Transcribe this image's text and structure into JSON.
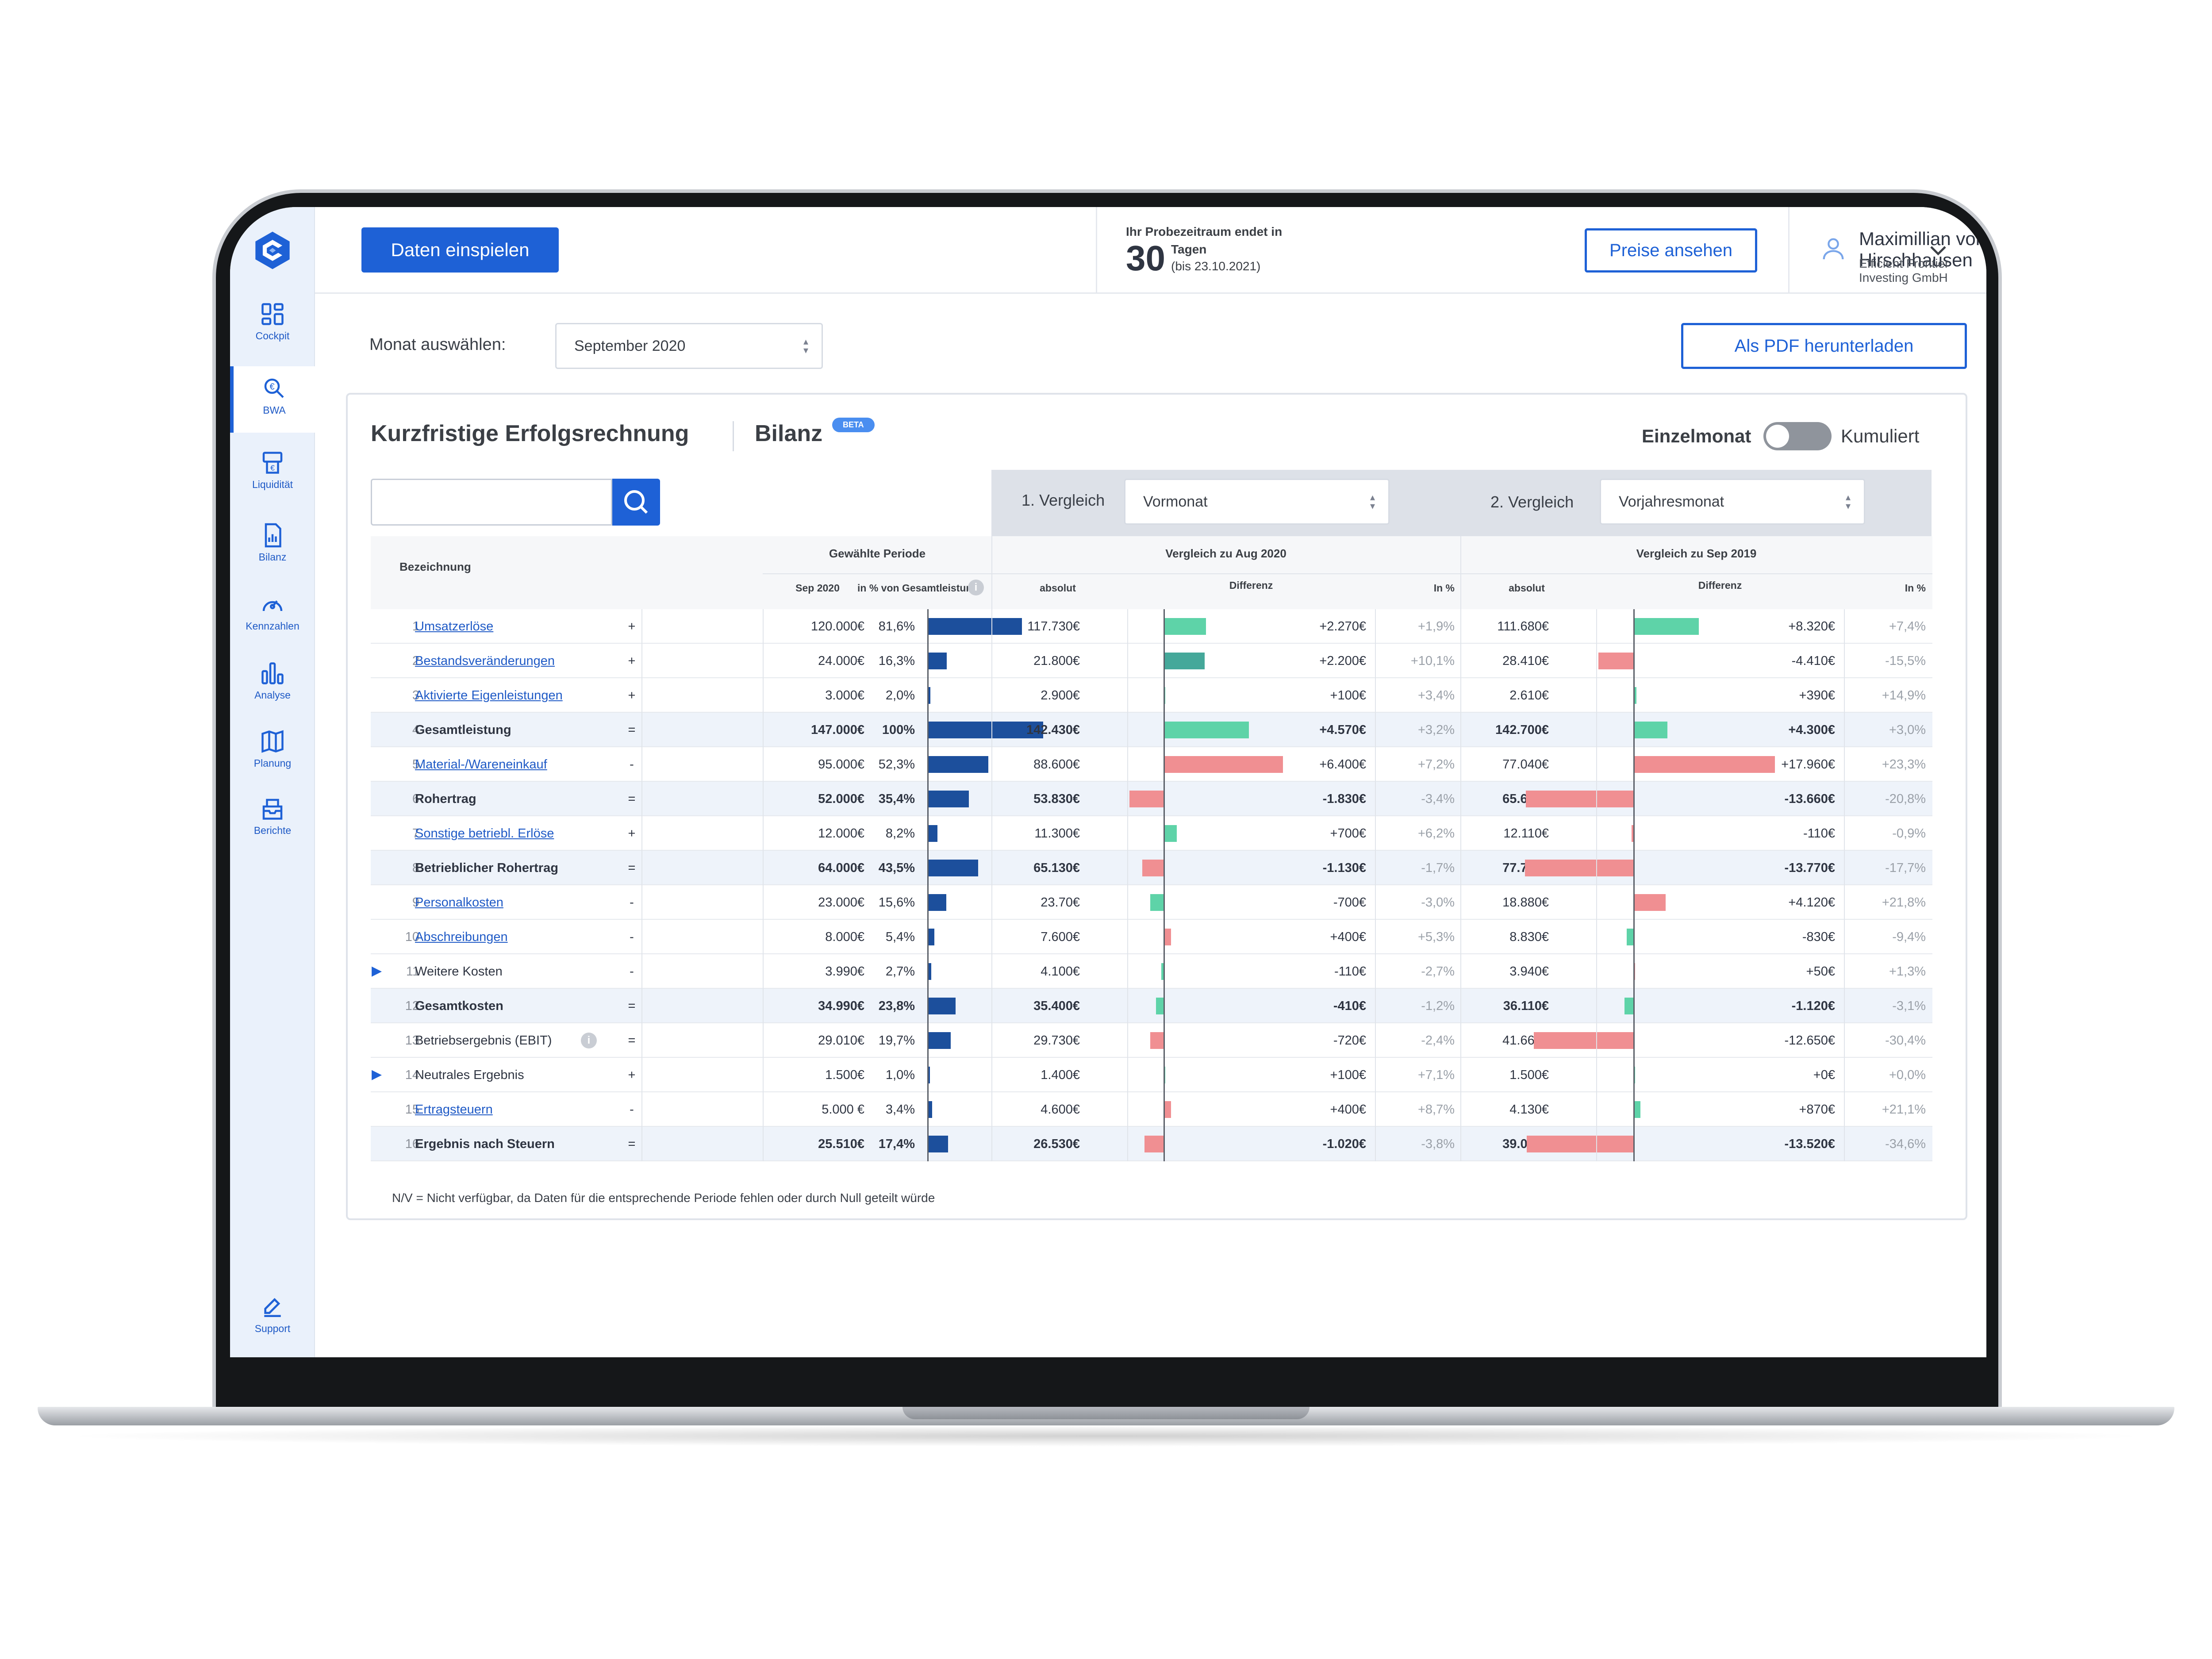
{
  "nav": [
    {
      "label": "Cockpit",
      "icon": "cockpit-icon"
    },
    {
      "label": "BWA",
      "icon": "bwa-icon"
    },
    {
      "label": "Liquidität",
      "icon": "liquidity-icon"
    },
    {
      "label": "Bilanz",
      "icon": "balance-icon"
    },
    {
      "label": "Kennzahlen",
      "icon": "gauge-icon"
    },
    {
      "label": "Analyse",
      "icon": "analysis-icon"
    },
    {
      "label": "Planung",
      "icon": "planning-icon"
    },
    {
      "label": "Berichte",
      "icon": "reports-icon"
    }
  ],
  "support_label": "Support",
  "header": {
    "import_button": "Daten einspielen",
    "trial_title": "Ihr Probezeitraum endet in",
    "trial_days": "30",
    "trial_unit": "Tagen",
    "trial_date": "(bis 23.10.2021)",
    "prices_button": "Preise ansehen",
    "user_name": "Maximillian von Hirschhausen",
    "company": "Efficient Frontier Investing GmbH"
  },
  "toolbar": {
    "month_label": "Monat auswählen:",
    "month_value": "September 2020",
    "pdf_button": "Als PDF herunterladen"
  },
  "report": {
    "title": "Kurzfristige Erfolgsrechnung",
    "tab2": "Bilanz",
    "beta": "BETA",
    "toggle_left": "Einzelmonat",
    "toggle_right": "Kumuliert",
    "cmp1_label": "1. Vergleich",
    "cmp1_value": "Vormonat",
    "cmp2_label": "2. Vergleich",
    "cmp2_value": "Vorjahresmonat"
  },
  "table": {
    "col_name": "Bezeichnung",
    "grp_selected": "Gewählte Periode",
    "grp_cmp1": "Vergleich zu Aug 2020",
    "grp_cmp2": "Vergleich zu Sep 2019",
    "sub_period": "Sep 2020",
    "sub_share": "in % von Gesamtleistung",
    "sub_abs1": "absolut",
    "sub_diff1": "Differenz",
    "sub_pct1": "In %",
    "sub_abs2": "absolut",
    "sub_diff2": "Differenz",
    "sub_pct2": "In %",
    "rows": [
      {
        "n": "1",
        "name": "Umsatzerlöse",
        "link": true,
        "bold": false,
        "op": "+",
        "val": "120.000€",
        "share": "81,6%",
        "shareV": 81.6,
        "a1": "117.730€",
        "d1": "+2.270€",
        "d1v": 2270,
        "p1": "+1,9%",
        "a2": "111.680€",
        "d2": "+8.320€",
        "d2v": 8320,
        "p2": "+7,4%"
      },
      {
        "n": "2",
        "name": "Bestandsveränderungen",
        "link": true,
        "bold": false,
        "op": "+",
        "val": "24.000€",
        "share": "16,3%",
        "shareV": 16.3,
        "a1": "21.800€",
        "d1": "+2.200€",
        "d1v": 2200,
        "p1": "+10,1%",
        "a2": "28.410€",
        "d2": "-4.410€",
        "d2v": -4410,
        "p2": "-15,5%"
      },
      {
        "n": "3",
        "name": "Aktivierte Eigenleistungen",
        "link": true,
        "bold": false,
        "op": "+",
        "val": "3.000€",
        "share": "2,0%",
        "shareV": 2.0,
        "a1": "2.900€",
        "d1": "+100€",
        "d1v": 100,
        "p1": "+3,4%",
        "a2": "2.610€",
        "d2": "+390€",
        "d2v": 390,
        "p2": "+14,9%"
      },
      {
        "n": "4",
        "name": "Gesamtleistung",
        "link": false,
        "bold": true,
        "op": "=",
        "val": "147.000€",
        "share": "100%",
        "shareV": 100,
        "a1": "142.430€",
        "d1": "+4.570€",
        "d1v": 4570,
        "p1": "+3,2%",
        "a2": "142.700€",
        "d2": "+4.300€",
        "d2v": 4300,
        "p2": "+3,0%"
      },
      {
        "n": "5",
        "name": "Material-/Wareneinkauf",
        "link": true,
        "bold": false,
        "op": "-",
        "val": "95.000€",
        "share": "52,3%",
        "shareV": 52.3,
        "a1": "88.600€",
        "d1": "+6.400€",
        "d1v": 6400,
        "d1neg": true,
        "p1": "+7,2%",
        "a2": "77.040€",
        "d2": "+17.960€",
        "d2v": 17960,
        "d2neg": true,
        "p2": "+23,3%"
      },
      {
        "n": "6",
        "name": "Rohertrag",
        "link": false,
        "bold": true,
        "op": "=",
        "val": "52.000€",
        "share": "35,4%",
        "shareV": 35.4,
        "a1": "53.830€",
        "d1": "-1.830€",
        "d1v": -1830,
        "p1": "-3,4%",
        "a2": "65.660€",
        "d2": "-13.660€",
        "d2v": -13660,
        "p2": "-20,8%"
      },
      {
        "n": "7",
        "name": "Sonstige betriebl. Erlöse",
        "link": true,
        "bold": false,
        "op": "+",
        "val": "12.000€",
        "share": "8,2%",
        "shareV": 8.2,
        "a1": "11.300€",
        "d1": "+700€",
        "d1v": 700,
        "p1": "+6,2%",
        "a2": "12.110€",
        "d2": "-110€",
        "d2v": -110,
        "p2": "-0,9%"
      },
      {
        "n": "8",
        "name": "Betrieblicher Rohertrag",
        "link": false,
        "bold": true,
        "op": "=",
        "val": "64.000€",
        "share": "43,5%",
        "shareV": 43.5,
        "a1": "65.130€",
        "d1": "-1.130€",
        "d1v": -1130,
        "p1": "-1,7%",
        "a2": "77.770€",
        "d2": "-13.770€",
        "d2v": -13770,
        "p2": "-17,7%"
      },
      {
        "n": "9",
        "name": "Personalkosten",
        "link": true,
        "bold": false,
        "op": "-",
        "val": "23.000€",
        "share": "15,6%",
        "shareV": 15.6,
        "a1": "23.70€",
        "d1": "-700€",
        "d1v": -700,
        "d1good": true,
        "p1": "-3,0%",
        "a2": "18.880€",
        "d2": "+4.120€",
        "d2v": 4120,
        "d2neg": true,
        "p2": "+21,8%"
      },
      {
        "n": "10",
        "name": "Abschreibungen",
        "link": true,
        "bold": false,
        "op": "-",
        "val": "8.000€",
        "share": "5,4%",
        "shareV": 5.4,
        "a1": "7.600€",
        "d1": "+400€",
        "d1v": 400,
        "d1neg": true,
        "p1": "+5,3%",
        "a2": "8.830€",
        "d2": "-830€",
        "d2v": -830,
        "d2good": true,
        "p2": "-9,4%"
      },
      {
        "n": "11",
        "name": "Weitere Kosten",
        "link": false,
        "bold": false,
        "expand": true,
        "op": "-",
        "val": "3.990€",
        "share": "2,7%",
        "shareV": 2.7,
        "a1": "4.100€",
        "d1": "-110€",
        "d1v": -110,
        "d1good": true,
        "p1": "-2,7%",
        "a2": "3.940€",
        "d2": "+50€",
        "d2v": 50,
        "d2neg": true,
        "p2": "+1,3%"
      },
      {
        "n": "12",
        "name": "Gesamtkosten",
        "link": false,
        "bold": true,
        "op": "=",
        "val": "34.990€",
        "share": "23,8%",
        "shareV": 23.8,
        "a1": "35.400€",
        "d1": "-410€",
        "d1v": -410,
        "d1good": true,
        "p1": "-1,2%",
        "a2": "36.110€",
        "d2": "-1.120€",
        "d2v": -1120,
        "d2good": true,
        "p2": "-3,1%"
      },
      {
        "n": "13",
        "name": "Betriebsergebnis (EBIT)",
        "link": false,
        "bold": false,
        "info": true,
        "op": "=",
        "val": "29.010€",
        "share": "19,7%",
        "shareV": 19.7,
        "a1": "29.730€",
        "d1": "-720€",
        "d1v": -720,
        "p1": "-2,4%",
        "a2": "41.660€",
        "d2": "-12.650€",
        "d2v": -12650,
        "p2": "-30,4%"
      },
      {
        "n": "14",
        "name": "Neutrales Ergebnis",
        "link": false,
        "bold": false,
        "expand": true,
        "op": "+",
        "val": "1.500€",
        "share": "1,0%",
        "shareV": 1.0,
        "a1": "1.400€",
        "d1": "+100€",
        "d1v": 100,
        "p1": "+7,1%",
        "a2": "1.500€",
        "d2": "+0€",
        "d2v": 0,
        "p2": "+0,0%"
      },
      {
        "n": "15",
        "name": "Ertragsteuern",
        "link": true,
        "bold": false,
        "op": "-",
        "val": "5.000 €",
        "share": "3,4%",
        "shareV": 3.4,
        "a1": "4.600€",
        "d1": "+400€",
        "d1v": 400,
        "d1neg": true,
        "p1": "+8,7%",
        "a2": "4.130€",
        "d2": "+870€",
        "d2v": 870,
        "p2": "+21,1%"
      },
      {
        "n": "16",
        "name": "Ergebnis nach Steuern",
        "link": false,
        "bold": true,
        "op": "=",
        "val": "25.510€",
        "share": "17,4%",
        "shareV": 17.4,
        "a1": "26.530€",
        "d1": "-1.020€",
        "d1v": -1020,
        "p1": "-3,8%",
        "a2": "39.030€",
        "d2": "-13.520€",
        "d2v": -13520,
        "p2": "-34,6%"
      }
    ]
  },
  "footnote": "N/V = Nicht verfügbar, da Daten für die entsprechende Periode fehlen oder durch Null geteilt würde",
  "colors": {
    "accent": "#1e61d6",
    "bar_share": "#1c4f9c",
    "pos": "#5ed3a8",
    "pos_dark": "#45a89a",
    "neg": "#f08f92"
  }
}
